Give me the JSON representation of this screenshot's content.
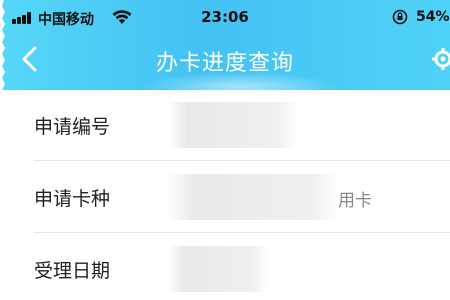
{
  "status_bar": {
    "carrier": "中国移动",
    "time": "23:06",
    "battery": "54%"
  },
  "nav": {
    "title": "办卡进度查询"
  },
  "rows": [
    {
      "label": "申请编号",
      "value": ""
    },
    {
      "label": "申请卡种",
      "value": "用卡"
    },
    {
      "label": "受理日期",
      "value": ""
    }
  ],
  "colors": {
    "header_blue": "#43c2f3",
    "header_light": "#56d6f7",
    "text": "#222222",
    "divider": "#e6e6e6"
  },
  "icons": {
    "back": "chevron-left-icon",
    "wifi": "wifi-icon",
    "rotation_lock": "rotation-lock-icon",
    "signal": "signal-icon",
    "nav_right": "settings-icon"
  }
}
